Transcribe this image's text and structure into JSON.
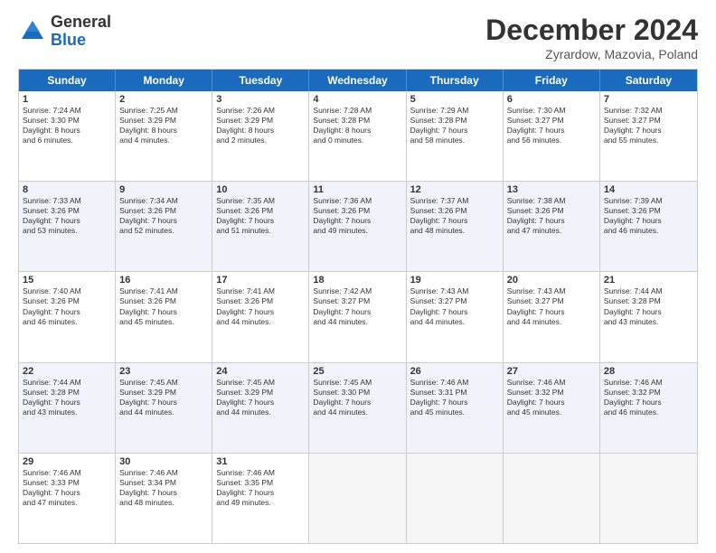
{
  "header": {
    "logo_general": "General",
    "logo_blue": "Blue",
    "month_title": "December 2024",
    "subtitle": "Zyrardow, Mazovia, Poland"
  },
  "days": [
    "Sunday",
    "Monday",
    "Tuesday",
    "Wednesday",
    "Thursday",
    "Friday",
    "Saturday"
  ],
  "rows": [
    [
      {
        "day": "1",
        "lines": [
          "Sunrise: 7:24 AM",
          "Sunset: 3:30 PM",
          "Daylight: 8 hours",
          "and 6 minutes."
        ]
      },
      {
        "day": "2",
        "lines": [
          "Sunrise: 7:25 AM",
          "Sunset: 3:29 PM",
          "Daylight: 8 hours",
          "and 4 minutes."
        ]
      },
      {
        "day": "3",
        "lines": [
          "Sunrise: 7:26 AM",
          "Sunset: 3:29 PM",
          "Daylight: 8 hours",
          "and 2 minutes."
        ]
      },
      {
        "day": "4",
        "lines": [
          "Sunrise: 7:28 AM",
          "Sunset: 3:28 PM",
          "Daylight: 8 hours",
          "and 0 minutes."
        ]
      },
      {
        "day": "5",
        "lines": [
          "Sunrise: 7:29 AM",
          "Sunset: 3:28 PM",
          "Daylight: 7 hours",
          "and 58 minutes."
        ]
      },
      {
        "day": "6",
        "lines": [
          "Sunrise: 7:30 AM",
          "Sunset: 3:27 PM",
          "Daylight: 7 hours",
          "and 56 minutes."
        ]
      },
      {
        "day": "7",
        "lines": [
          "Sunrise: 7:32 AM",
          "Sunset: 3:27 PM",
          "Daylight: 7 hours",
          "and 55 minutes."
        ]
      }
    ],
    [
      {
        "day": "8",
        "lines": [
          "Sunrise: 7:33 AM",
          "Sunset: 3:26 PM",
          "Daylight: 7 hours",
          "and 53 minutes."
        ]
      },
      {
        "day": "9",
        "lines": [
          "Sunrise: 7:34 AM",
          "Sunset: 3:26 PM",
          "Daylight: 7 hours",
          "and 52 minutes."
        ]
      },
      {
        "day": "10",
        "lines": [
          "Sunrise: 7:35 AM",
          "Sunset: 3:26 PM",
          "Daylight: 7 hours",
          "and 51 minutes."
        ]
      },
      {
        "day": "11",
        "lines": [
          "Sunrise: 7:36 AM",
          "Sunset: 3:26 PM",
          "Daylight: 7 hours",
          "and 49 minutes."
        ]
      },
      {
        "day": "12",
        "lines": [
          "Sunrise: 7:37 AM",
          "Sunset: 3:26 PM",
          "Daylight: 7 hours",
          "and 48 minutes."
        ]
      },
      {
        "day": "13",
        "lines": [
          "Sunrise: 7:38 AM",
          "Sunset: 3:26 PM",
          "Daylight: 7 hours",
          "and 47 minutes."
        ]
      },
      {
        "day": "14",
        "lines": [
          "Sunrise: 7:39 AM",
          "Sunset: 3:26 PM",
          "Daylight: 7 hours",
          "and 46 minutes."
        ]
      }
    ],
    [
      {
        "day": "15",
        "lines": [
          "Sunrise: 7:40 AM",
          "Sunset: 3:26 PM",
          "Daylight: 7 hours",
          "and 46 minutes."
        ]
      },
      {
        "day": "16",
        "lines": [
          "Sunrise: 7:41 AM",
          "Sunset: 3:26 PM",
          "Daylight: 7 hours",
          "and 45 minutes."
        ]
      },
      {
        "day": "17",
        "lines": [
          "Sunrise: 7:41 AM",
          "Sunset: 3:26 PM",
          "Daylight: 7 hours",
          "and 44 minutes."
        ]
      },
      {
        "day": "18",
        "lines": [
          "Sunrise: 7:42 AM",
          "Sunset: 3:27 PM",
          "Daylight: 7 hours",
          "and 44 minutes."
        ]
      },
      {
        "day": "19",
        "lines": [
          "Sunrise: 7:43 AM",
          "Sunset: 3:27 PM",
          "Daylight: 7 hours",
          "and 44 minutes."
        ]
      },
      {
        "day": "20",
        "lines": [
          "Sunrise: 7:43 AM",
          "Sunset: 3:27 PM",
          "Daylight: 7 hours",
          "and 44 minutes."
        ]
      },
      {
        "day": "21",
        "lines": [
          "Sunrise: 7:44 AM",
          "Sunset: 3:28 PM",
          "Daylight: 7 hours",
          "and 43 minutes."
        ]
      }
    ],
    [
      {
        "day": "22",
        "lines": [
          "Sunrise: 7:44 AM",
          "Sunset: 3:28 PM",
          "Daylight: 7 hours",
          "and 43 minutes."
        ]
      },
      {
        "day": "23",
        "lines": [
          "Sunrise: 7:45 AM",
          "Sunset: 3:29 PM",
          "Daylight: 7 hours",
          "and 44 minutes."
        ]
      },
      {
        "day": "24",
        "lines": [
          "Sunrise: 7:45 AM",
          "Sunset: 3:29 PM",
          "Daylight: 7 hours",
          "and 44 minutes."
        ]
      },
      {
        "day": "25",
        "lines": [
          "Sunrise: 7:45 AM",
          "Sunset: 3:30 PM",
          "Daylight: 7 hours",
          "and 44 minutes."
        ]
      },
      {
        "day": "26",
        "lines": [
          "Sunrise: 7:46 AM",
          "Sunset: 3:31 PM",
          "Daylight: 7 hours",
          "and 45 minutes."
        ]
      },
      {
        "day": "27",
        "lines": [
          "Sunrise: 7:46 AM",
          "Sunset: 3:32 PM",
          "Daylight: 7 hours",
          "and 45 minutes."
        ]
      },
      {
        "day": "28",
        "lines": [
          "Sunrise: 7:46 AM",
          "Sunset: 3:32 PM",
          "Daylight: 7 hours",
          "and 46 minutes."
        ]
      }
    ],
    [
      {
        "day": "29",
        "lines": [
          "Sunrise: 7:46 AM",
          "Sunset: 3:33 PM",
          "Daylight: 7 hours",
          "and 47 minutes."
        ]
      },
      {
        "day": "30",
        "lines": [
          "Sunrise: 7:46 AM",
          "Sunset: 3:34 PM",
          "Daylight: 7 hours",
          "and 48 minutes."
        ]
      },
      {
        "day": "31",
        "lines": [
          "Sunrise: 7:46 AM",
          "Sunset: 3:35 PM",
          "Daylight: 7 hours",
          "and 49 minutes."
        ]
      },
      null,
      null,
      null,
      null
    ]
  ]
}
